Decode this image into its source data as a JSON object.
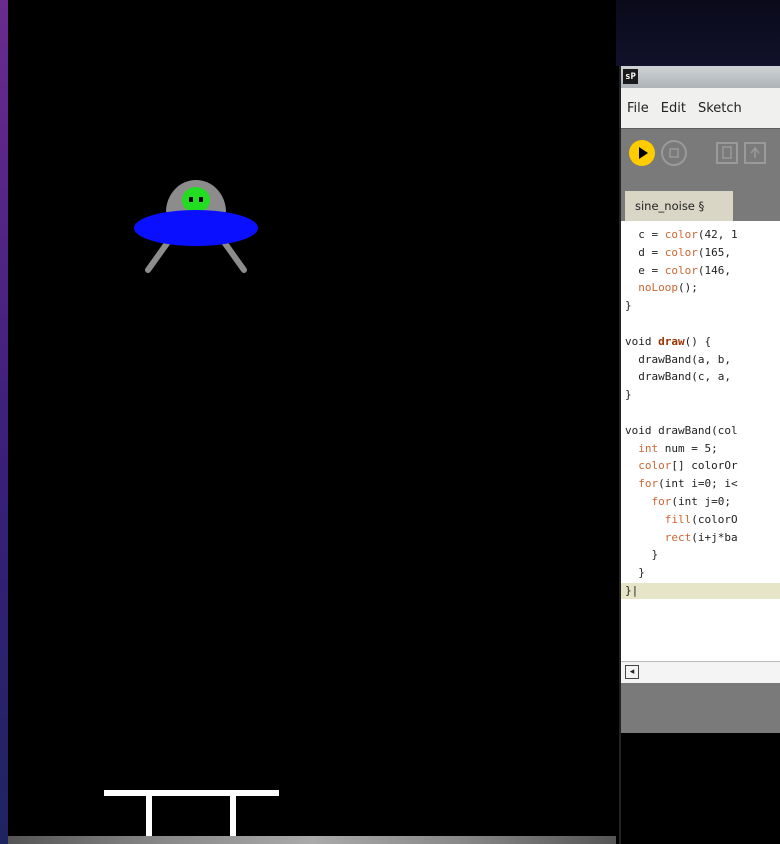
{
  "ide": {
    "app_icon": "sP",
    "menu": [
      "File",
      "Edit",
      "Sketch"
    ],
    "tab_label": "sine_noise §",
    "toolbar_icons": [
      "run-icon",
      "stop-icon",
      "new-icon",
      "open-icon"
    ],
    "code": [
      {
        "pre": "  c = ",
        "kw": "color",
        "post": "(42, 1"
      },
      {
        "pre": "  d = ",
        "kw": "color",
        "post": "(165,"
      },
      {
        "pre": "  e = ",
        "kw": "color",
        "post": "(146,"
      },
      {
        "pre": "  ",
        "kw": "noLoop",
        "post": "();"
      },
      {
        "pre": "}",
        "kw": "",
        "post": ""
      },
      {
        "pre": "",
        "kw": "",
        "post": ""
      },
      {
        "pre": "void ",
        "fn": "draw",
        "post": "() {"
      },
      {
        "pre": "  drawBand(a, b,",
        "kw": "",
        "post": ""
      },
      {
        "pre": "  drawBand(c, a,",
        "kw": "",
        "post": ""
      },
      {
        "pre": "}",
        "kw": "",
        "post": ""
      },
      {
        "pre": "",
        "kw": "",
        "post": ""
      },
      {
        "pre": "void drawBand(col",
        "kw": "",
        "post": ""
      },
      {
        "pre": "  ",
        "kw": "int",
        "post": " num = 5;"
      },
      {
        "pre": "  ",
        "kw": "color",
        "post": "[] colorOr"
      },
      {
        "pre": "  ",
        "kw": "for",
        "post": "(int i=0; i<"
      },
      {
        "pre": "    ",
        "kw": "for",
        "post": "(int j=0;"
      },
      {
        "pre": "      ",
        "kw": "fill",
        "post": "(colorO"
      },
      {
        "pre": "      ",
        "kw": "rect",
        "post": "(i+j*ba"
      },
      {
        "pre": "    }",
        "kw": "",
        "post": ""
      },
      {
        "pre": "  }",
        "kw": "",
        "post": ""
      },
      {
        "pre": "}|",
        "kw": "",
        "post": ""
      }
    ]
  },
  "colors": {
    "ufo_body": "#0a10ff",
    "ufo_dome": "#8c8c8c",
    "alien": "#22dd22",
    "run_button": "#ffcc00",
    "current_line": "#e6e5c8"
  }
}
